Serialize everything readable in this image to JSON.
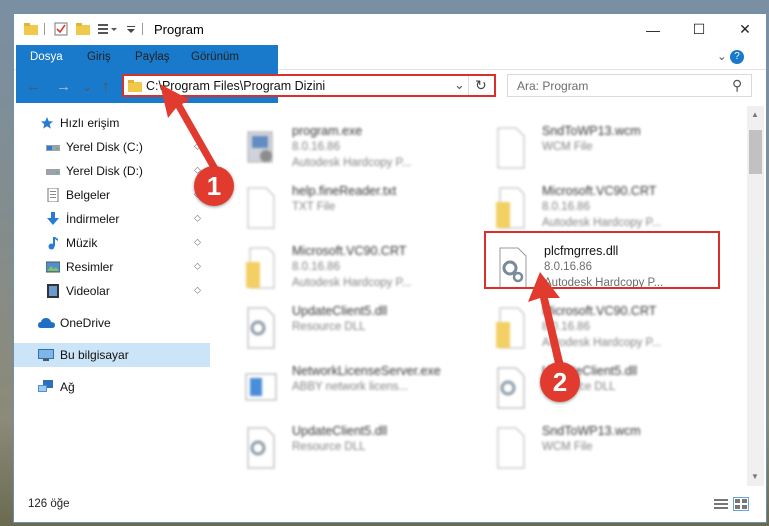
{
  "window": {
    "title": "Program",
    "minimize_icon": "—",
    "maximize_icon": "☐",
    "close_icon": "✕"
  },
  "ribbon": {
    "tabs": [
      "Dosya",
      "Giriş",
      "Paylaş",
      "Görünüm"
    ],
    "expand_icon": "⌄",
    "help_icon": "?"
  },
  "nav": {
    "back": "←",
    "forward": "→",
    "recent": "⌄",
    "up": "↑",
    "address": "C:\\Program Files\\Program Dizini",
    "address_dropdown": "⌄",
    "refresh": "↻",
    "search_placeholder": "Ara: Program",
    "search_icon": "⚲"
  },
  "sidebar": {
    "items": [
      {
        "label": "Hızlı erişim",
        "icon": "star-icon",
        "pinned": false
      },
      {
        "label": "Yerel Disk (C:)",
        "icon": "drive-icon",
        "pinned": true
      },
      {
        "label": "Yerel Disk (D:)",
        "icon": "drive-icon",
        "pinned": true
      },
      {
        "label": "Belgeler",
        "icon": "documents-icon",
        "pinned": true
      },
      {
        "label": "İndirmeler",
        "icon": "download-icon",
        "pinned": true
      },
      {
        "label": "Müzik",
        "icon": "music-icon",
        "pinned": true
      },
      {
        "label": "Resimler",
        "icon": "pictures-icon",
        "pinned": true
      },
      {
        "label": "Videolar",
        "icon": "videos-icon",
        "pinned": true
      },
      {
        "label": "OneDrive",
        "icon": "cloud-icon",
        "pinned": false
      },
      {
        "label": "Bu bilgisayar",
        "icon": "computer-icon",
        "pinned": false
      },
      {
        "label": "Ağ",
        "icon": "network-icon",
        "pinned": false
      }
    ],
    "pin_glyph": "📌"
  },
  "files": [
    {
      "name": "program.exe",
      "line2": "8.0.16.86",
      "line3": "Autodesk Hardcopy P...",
      "icon": "exe-icon"
    },
    {
      "name": "SndToWP13.wcm",
      "line2": "WCM File",
      "line3": "",
      "icon": "file-icon"
    },
    {
      "name": "help.fineReader.txt",
      "line2": "TXT File",
      "line3": "",
      "icon": "file-icon"
    },
    {
      "name": "Microsoft.VC90.CRT",
      "line2": "8.0.16.86",
      "line3": "Autodesk Hardcopy P...",
      "icon": "folder-doc-icon"
    },
    {
      "name": "Microsoft.VC90.CRT",
      "line2": "8.0.16.86",
      "line3": "Autodesk Hardcopy P...",
      "icon": "folder-doc-icon"
    },
    {
      "name": "plcfmgrres.dll",
      "line2": "8.0.16.86",
      "line3": "Autodesk Hardcopy P...",
      "icon": "dll-icon"
    },
    {
      "name": "UpdateClient5.dll",
      "line2": "Resource DLL",
      "line3": "",
      "icon": "dll-icon"
    },
    {
      "name": "Microsoft.VC90.CRT",
      "line2": "8.0.16.86",
      "line3": "Autodesk Hardcopy P...",
      "icon": "folder-doc-icon"
    },
    {
      "name": "NetworkLicenseServer.exe",
      "line2": "ABBY network licens...",
      "line3": "",
      "icon": "app-icon"
    },
    {
      "name": "UpdateClient5.dll",
      "line2": "Resource DLL",
      "line3": "",
      "icon": "dll-icon"
    },
    {
      "name": "UpdateClient5.dll",
      "line2": "Resource DLL",
      "line3": "",
      "icon": "dll-icon"
    },
    {
      "name": "SndToWP13.wcm",
      "line2": "WCM File",
      "line3": "",
      "icon": "file-icon"
    }
  ],
  "status": {
    "count": "126 öğe"
  },
  "annotations": {
    "step1": "1",
    "step2": "2",
    "color": "#e03b2e"
  }
}
